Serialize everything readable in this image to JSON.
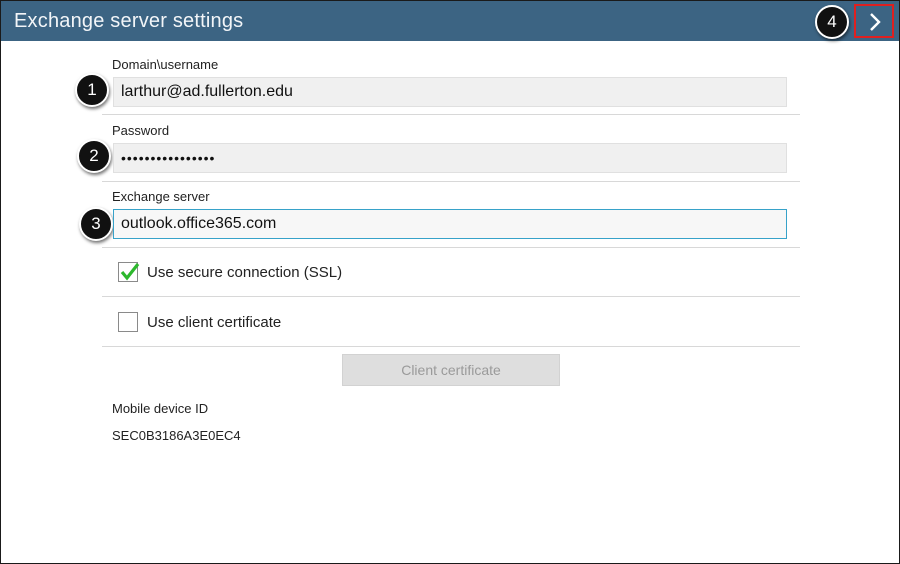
{
  "header": {
    "title": "Exchange server settings",
    "next_icon": "chevron-right-icon",
    "accent_color": "#3c6483",
    "highlight_color": "#e02020"
  },
  "callouts": [
    "1",
    "2",
    "3",
    "4"
  ],
  "form": {
    "domain_label": "Domain\\username",
    "domain_value": "larthur@ad.fullerton.edu",
    "password_label": "Password",
    "password_value": "••••••••••••••••",
    "server_label": "Exchange server",
    "server_value": "outlook.office365.com",
    "ssl_label": "Use secure connection (SSL)",
    "ssl_checked": true,
    "client_cert_label": "Use client certificate",
    "client_cert_checked": false,
    "client_cert_button": "Client certificate",
    "device_id_label": "Mobile device ID",
    "device_id_value": "SEC0B3186A3E0EC4"
  }
}
